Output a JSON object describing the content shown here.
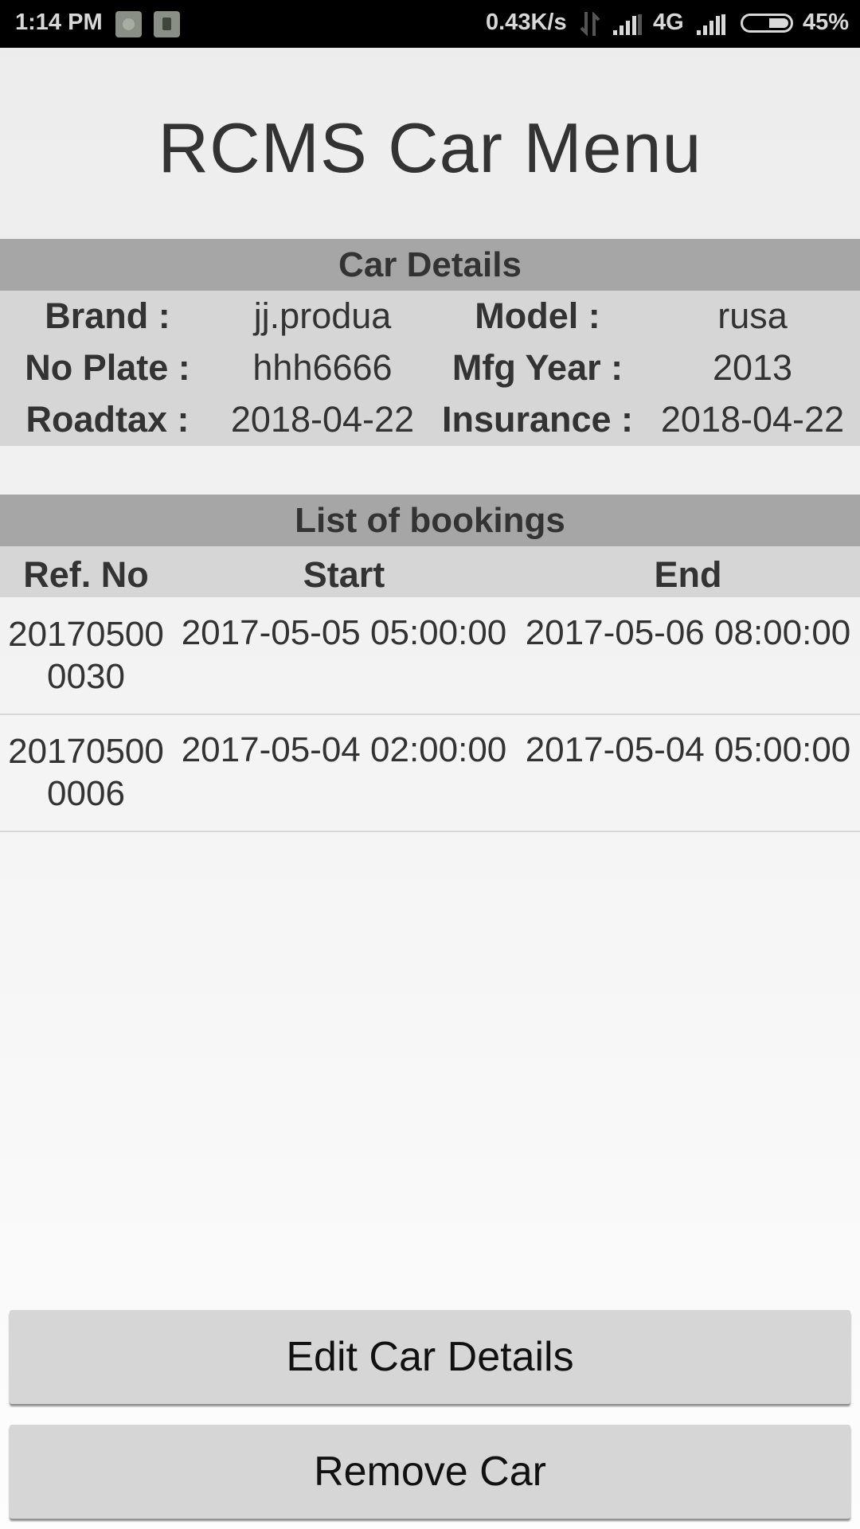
{
  "status_bar": {
    "time": "1:14 PM",
    "net_speed": "0.43K/s",
    "network_type": "4G",
    "battery_percent": "45%",
    "battery_level": 0.45,
    "icons": [
      "notification-app-icon",
      "notification-app-icon",
      "data-transfer-arrows-icon",
      "signal-icon",
      "signal-icon",
      "battery-icon"
    ]
  },
  "page": {
    "title": "RCMS Car Menu"
  },
  "car_details": {
    "header": "Car Details",
    "rows": [
      [
        {
          "label": "Brand :",
          "value": "jj.produa"
        },
        {
          "label": "Model :",
          "value": "rusa"
        }
      ],
      [
        {
          "label": "No Plate :",
          "value": "hhh6666"
        },
        {
          "label": "Mfg Year :",
          "value": "2013"
        }
      ],
      [
        {
          "label": "Roadtax :",
          "value": "2018-04-22"
        },
        {
          "label": "Insurance :",
          "value": "2018-04-22"
        }
      ]
    ]
  },
  "bookings": {
    "header": "List of bookings",
    "columns": [
      "Ref. No",
      "Start",
      "End"
    ],
    "rows": [
      {
        "ref_line1": "20170500",
        "ref_line2": "0030",
        "start": "2017-05-05 05:00:00",
        "end": "2017-05-06 08:00:00"
      },
      {
        "ref_line1": "20170500",
        "ref_line2": "0006",
        "start": "2017-05-04 02:00:00",
        "end": "2017-05-04 05:00:00"
      }
    ]
  },
  "actions": {
    "edit_label": "Edit Car Details",
    "remove_label": "Remove Car"
  }
}
